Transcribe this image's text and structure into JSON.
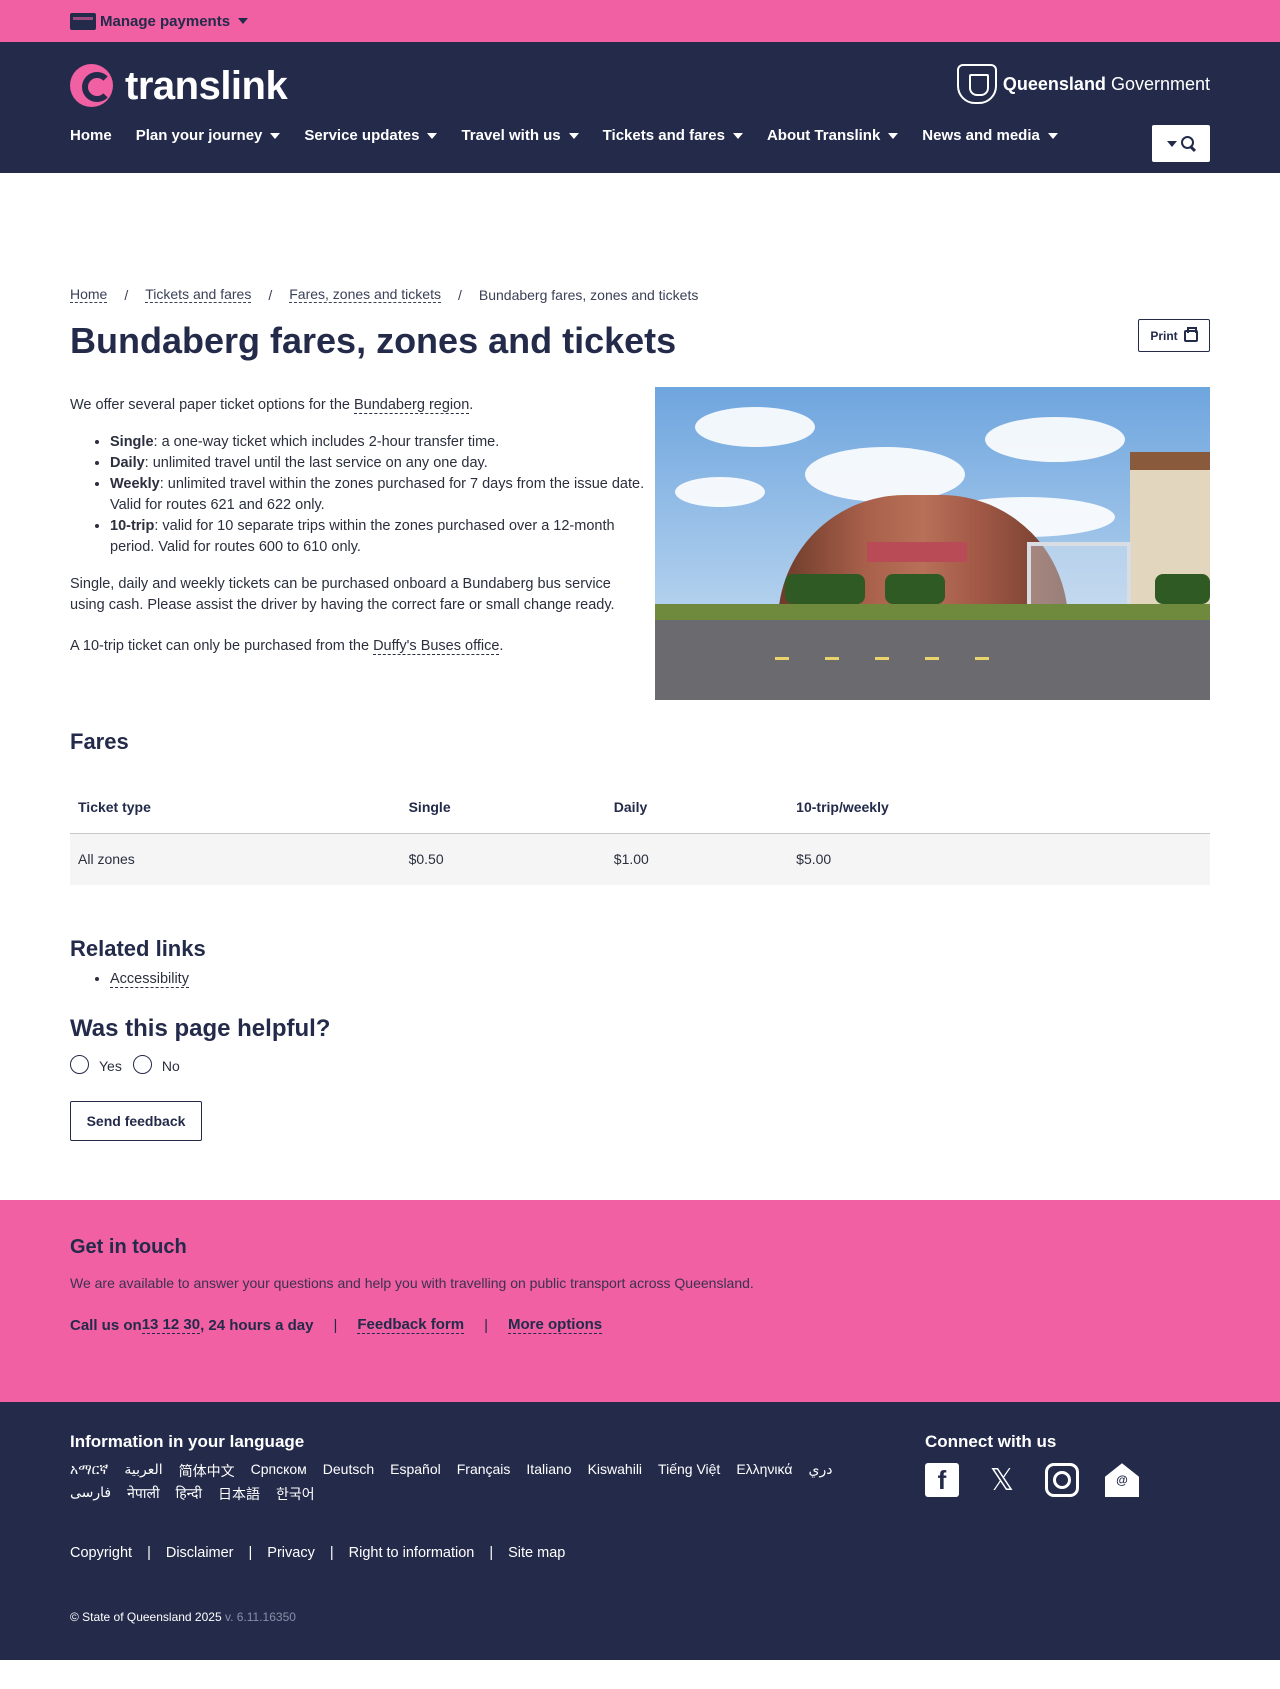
{
  "paybar": {
    "label": "Manage payments"
  },
  "header": {
    "logo_text": "translink",
    "gov_bold": "Queensland",
    "gov_rest": "Government",
    "nav": [
      {
        "label": "Home",
        "has_menu": false
      },
      {
        "label": "Plan your journey",
        "has_menu": true
      },
      {
        "label": "Service updates",
        "has_menu": true
      },
      {
        "label": "Travel with us",
        "has_menu": true
      },
      {
        "label": "Tickets and fares",
        "has_menu": true
      },
      {
        "label": "About Translink",
        "has_menu": true
      },
      {
        "label": "News and media",
        "has_menu": true
      }
    ]
  },
  "breadcrumb": [
    "Home",
    "Tickets and fares",
    "Fares, zones and tickets",
    "Bundaberg fares, zones and tickets"
  ],
  "page": {
    "title": "Bundaberg fares, zones and tickets",
    "print_label": "Print",
    "intro_prefix": "We offer several paper ticket options for the ",
    "intro_link": "Bundaberg region",
    "intro_suffix": ".",
    "tickets": [
      {
        "name": "Single",
        "desc": ": a one-way ticket which includes 2-hour transfer time."
      },
      {
        "name": "Daily",
        "desc": ": unlimited travel until the last service on any one day."
      },
      {
        "name": "Weekly",
        "desc": ": unlimited travel within the zones purchased for 7 days from the issue date. Valid for routes 621 and 622 only."
      },
      {
        "name": "10-trip",
        "desc": ": valid for 10 separate trips within the zones purchased over a 12-month period. Valid for routes 600 to 610 only."
      }
    ],
    "purchase_note": "Single, daily and weekly tickets can be purchased onboard a Bundaberg bus service using cash. Please assist the driver by having the correct fare or small change ready.",
    "tentrip_prefix": "A 10-trip ticket can only be purchased from the ",
    "tentrip_link": "Duffy's Buses office",
    "tentrip_suffix": "."
  },
  "fares": {
    "heading": "Fares",
    "columns": [
      "Ticket type",
      "Single",
      "Daily",
      "10-trip/weekly"
    ],
    "rows": [
      [
        "All zones",
        "$0.50",
        "$1.00",
        "$5.00"
      ]
    ]
  },
  "related": {
    "heading": "Related links",
    "links": [
      "Accessibility"
    ]
  },
  "feedback": {
    "heading": "Was this page helpful?",
    "yes": "Yes",
    "no": "No",
    "send": "Send feedback"
  },
  "touch": {
    "heading": "Get in touch",
    "text": "We are available to answer your questions and help you with travelling on public transport across Queensland.",
    "call_prefix": "Call us on ",
    "phone": "13 12 30",
    "call_suffix": ", 24 hours a day",
    "feedback_form": "Feedback form",
    "more_options": "More options"
  },
  "footer": {
    "lang_heading": "Information in your language",
    "languages": [
      "አማርኛ",
      "العربية",
      "简体中文",
      "Српском",
      "Deutsch",
      "Español",
      "Français",
      "Italiano",
      "Kiswahili",
      "Tiếng Việt",
      "Ελληνικά",
      "دري",
      "فارسی",
      "नेपाली",
      "हिन्दी",
      "日本語",
      "한국어"
    ],
    "connect_heading": "Connect with us",
    "links": [
      "Copyright",
      "Disclaimer",
      "Privacy",
      "Right to information",
      "Site map"
    ],
    "copyright": "© State of Queensland 2025",
    "version": "v. 6.11.16350"
  },
  "colors": {
    "pink": "#f060a3",
    "navy": "#242a4a"
  }
}
